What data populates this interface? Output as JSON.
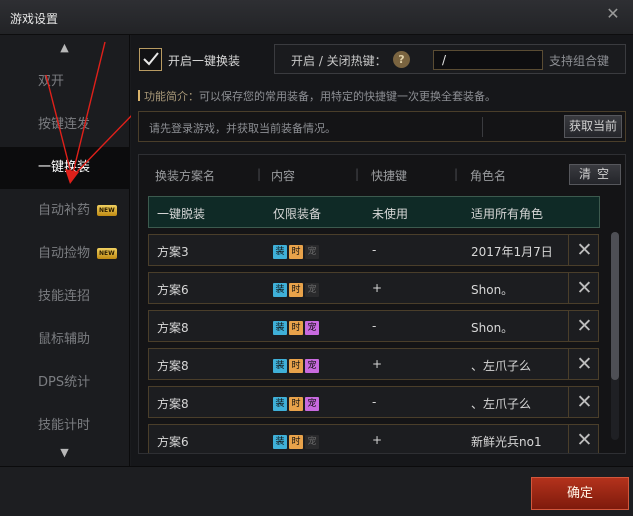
{
  "window": {
    "title": "游戏设置",
    "close_icon": "close-icon"
  },
  "sidebar": {
    "items": [
      {
        "label": "双开",
        "badge": ""
      },
      {
        "label": "按键连发",
        "badge": ""
      },
      {
        "label": "一键换装",
        "badge": "",
        "active": true
      },
      {
        "label": "自动补药",
        "badge": "NEW"
      },
      {
        "label": "自动捡物",
        "badge": "NEW"
      },
      {
        "label": "技能连招",
        "badge": ""
      },
      {
        "label": "鼠标辅助",
        "badge": ""
      },
      {
        "label": "DPS统计",
        "badge": ""
      },
      {
        "label": "技能计时",
        "badge": ""
      }
    ]
  },
  "toggle": {
    "label": "开启一键换装",
    "checked": true
  },
  "hotkey": {
    "label": "开启 / 关闭热键：",
    "value": "/",
    "hint": "支持组合键",
    "help_icon": "help-icon"
  },
  "intro": {
    "label": "功能简介：",
    "text": "可以保存您的常用装备，用特定的快捷键一次更换全套装备。"
  },
  "login": {
    "text": "请先登录游戏，并获取当前装备情况。",
    "button": "获取当前"
  },
  "table": {
    "headers": [
      "换装方案名",
      "内容",
      "快捷键",
      "角色名"
    ],
    "clear_button": "清空",
    "rows": [
      {
        "name": "一键脱装",
        "content": "仅限装备",
        "hotkey": "未使用",
        "role": "适用所有角色",
        "tags": []
      },
      {
        "name": "方案3",
        "content": "",
        "hotkey": "-",
        "role": "2017年1月7日",
        "tags": [
          "装",
          "时",
          "宠"
        ],
        "pet_on": false
      },
      {
        "name": "方案6",
        "content": "",
        "hotkey": "+",
        "role": "Shon。",
        "tags": [
          "装",
          "时",
          "宠"
        ],
        "pet_on": false
      },
      {
        "name": "方案8",
        "content": "",
        "hotkey": "-",
        "role": "Shon。",
        "tags": [
          "装",
          "时",
          "宠"
        ],
        "pet_on": true
      },
      {
        "name": "方案8",
        "content": "",
        "hotkey": "+",
        "role": "、左爪子么",
        "tags": [
          "装",
          "时",
          "宠"
        ],
        "pet_on": true
      },
      {
        "name": "方案8",
        "content": "",
        "hotkey": "-",
        "role": "、左爪子么",
        "tags": [
          "装",
          "时",
          "宠"
        ],
        "pet_on": true
      },
      {
        "name": "方案6",
        "content": "",
        "hotkey": "+",
        "role": "新鲜光兵no1",
        "tags": [
          "装",
          "时",
          "宠"
        ],
        "pet_on": false
      }
    ]
  },
  "footer": {
    "ok_button": "确定"
  },
  "colors": {
    "accent_gold": "#d9b26a",
    "confirm_red": "#b3321c",
    "tag_equip": "#3fb0d8",
    "tag_time": "#e8a24a",
    "tag_pet": "#c86adf"
  }
}
